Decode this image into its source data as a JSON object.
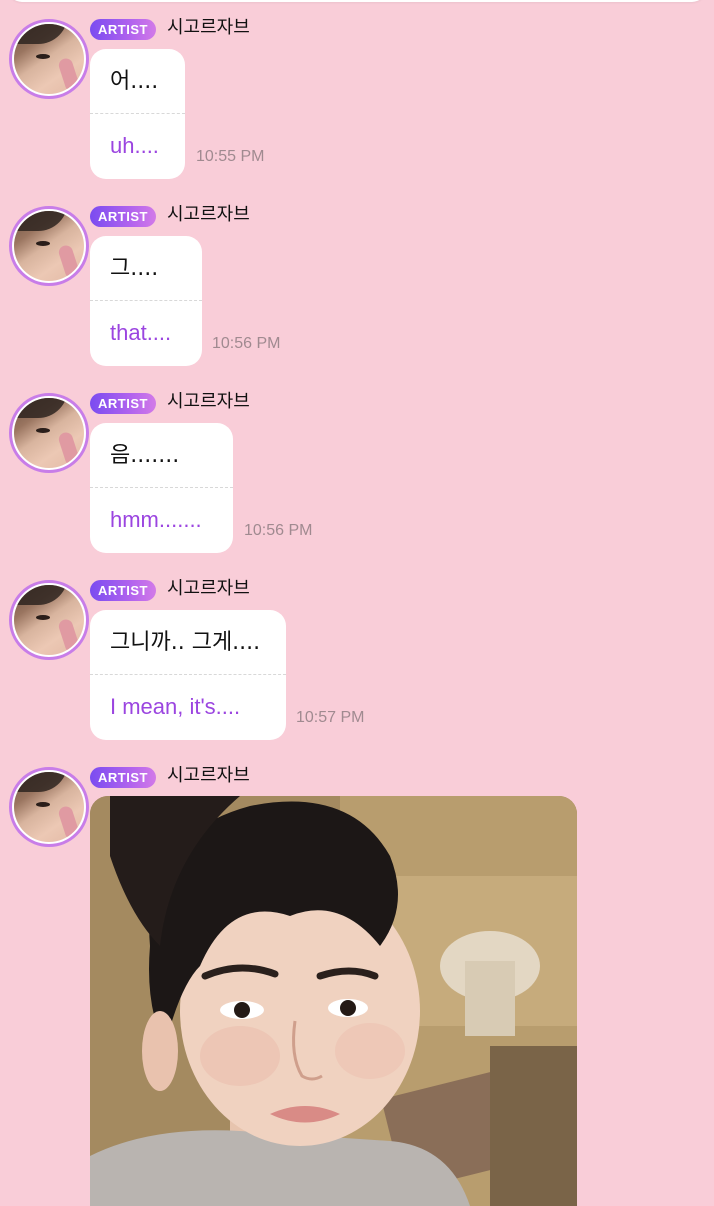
{
  "messages": [
    {
      "badge": "ARTIST",
      "name": "시고르자브",
      "original": "어....",
      "translation": "uh....",
      "time": "10:55 PM"
    },
    {
      "badge": "ARTIST",
      "name": "시고르자브",
      "original": "그....",
      "translation": "that....",
      "time": "10:56 PM"
    },
    {
      "badge": "ARTIST",
      "name": "시고르자브",
      "original": "음.......",
      "translation": "hmm.......",
      "time": "10:56 PM"
    },
    {
      "badge": "ARTIST",
      "name": "시고르자브",
      "original": "그니까.. 그게....",
      "translation": "I mean, it's....",
      "time": "10:57 PM"
    }
  ],
  "photo_message": {
    "badge": "ARTIST",
    "name": "시고르자브"
  },
  "colors": {
    "background": "#f9cdd8",
    "bubble": "#ffffff",
    "translation_text": "#9b45e0",
    "badge_start": "#7a4cf0",
    "badge_end": "#d27ae8",
    "avatar_ring": "#c87de8",
    "timestamp": "#a08a90"
  },
  "icons": {
    "avatar": "artist-avatar"
  }
}
